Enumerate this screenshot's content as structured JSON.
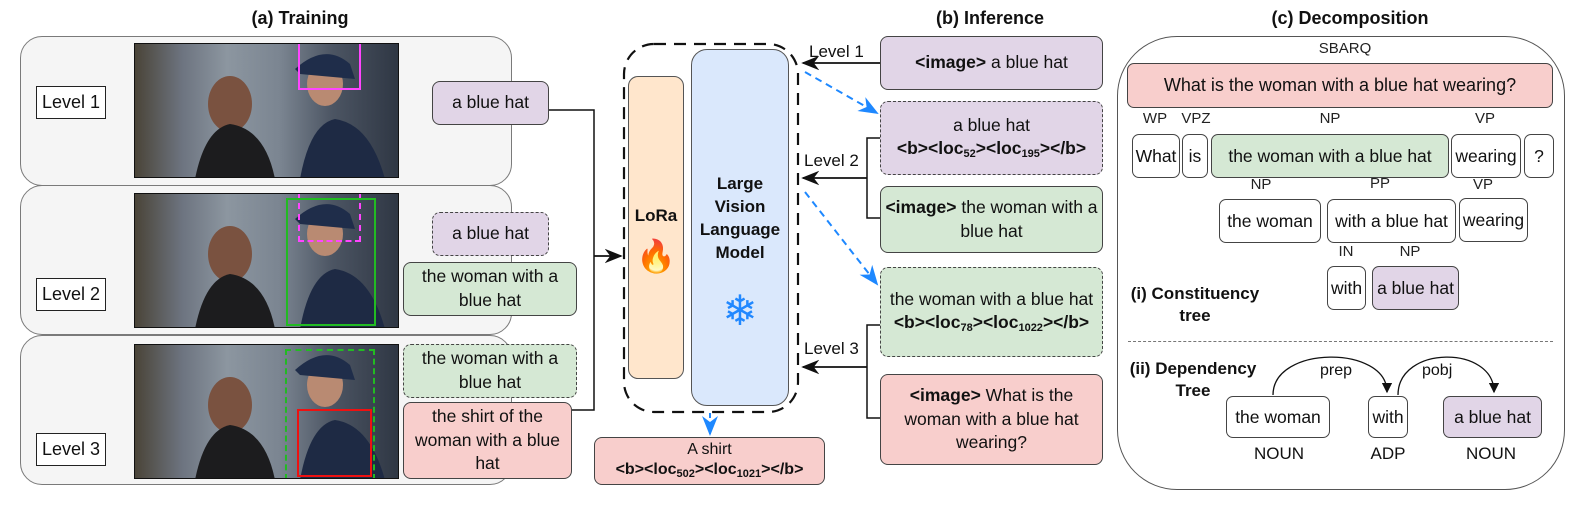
{
  "titles": {
    "training": "(a) Training",
    "inference": "(b) Inference",
    "decomposition": "(c) Decomposition"
  },
  "training": {
    "levels": [
      {
        "label": "Level 1",
        "image_boxes": [
          {
            "color": "#ff44ff",
            "style": "solid",
            "target": "hat"
          }
        ],
        "texts": [
          {
            "text": "a blue hat",
            "color": "#e1d5e7",
            "style": "solid"
          }
        ]
      },
      {
        "label": "Level 2",
        "image_boxes": [
          {
            "color": "#ff44ff",
            "style": "dashed",
            "target": "hat"
          },
          {
            "color": "#22bb22",
            "style": "solid",
            "target": "woman"
          }
        ],
        "texts": [
          {
            "text": "a blue hat",
            "color": "#e1d5e7",
            "style": "dashed"
          },
          {
            "text": "the woman with a blue hat",
            "color": "#d5e8d4",
            "style": "solid"
          }
        ]
      },
      {
        "label": "Level 3",
        "image_boxes": [
          {
            "color": "#22bb22",
            "style": "dashed",
            "target": "woman"
          },
          {
            "color": "#ee1111",
            "style": "solid",
            "target": "shirt"
          }
        ],
        "texts": [
          {
            "text": "the woman with a blue hat",
            "color": "#d5e8d4",
            "style": "dashed"
          },
          {
            "text": "the shirt of the woman with a blue hat",
            "color": "#f8cecc",
            "style": "solid"
          }
        ]
      }
    ]
  },
  "model": {
    "lora_label": "LoRa",
    "lora_icon": "fire-icon",
    "lora_glyph": "🔥",
    "lvlm_label": "Large Vision Language Model",
    "lvlm_icon": "snowflake-icon",
    "lvlm_glyph": "❄",
    "output": {
      "line1": "A shirt",
      "open": "<b><loc",
      "loc1": "502",
      "mid": "><loc",
      "loc2": "1021",
      "close": "></b>"
    }
  },
  "inference": {
    "arrow_labels": [
      "Level 1",
      "Level 2",
      "Level 3"
    ],
    "boxes": [
      {
        "bold": "<image>",
        "text": " a blue hat",
        "color": "#e1d5e7",
        "style": "solid"
      },
      {
        "text": "a blue hat",
        "tag_open": "<b><loc",
        "loc1": "52",
        "tag_mid": "><loc",
        "loc2": "195",
        "tag_close": "></b>",
        "color": "#e1d5e7",
        "style": "dashed"
      },
      {
        "bold": "<image>",
        "text": " the woman with a blue hat",
        "color": "#d5e8d4",
        "style": "solid"
      },
      {
        "text": "the woman with a blue hat ",
        "tag_open": "<b><loc",
        "loc1": "78",
        "tag_mid": "><loc",
        "loc2": "1022",
        "tag_close": "></b>",
        "color": "#d5e8d4",
        "style": "dashed"
      },
      {
        "bold": "<image>",
        "text": " What is the woman with a blue hat wearing?",
        "color": "#f8cecc",
        "style": "solid"
      }
    ]
  },
  "decomposition": {
    "root_tag": "SBARQ",
    "question": "What is the woman with a blue hat wearing?",
    "row1": {
      "tags": [
        "WP",
        "VPZ",
        "NP",
        "VP"
      ],
      "words": [
        "What",
        "is",
        "the woman with a blue hat",
        "wearing",
        "?"
      ]
    },
    "row2": {
      "tags": [
        "NP",
        "PP",
        "VP"
      ],
      "words": [
        "the woman",
        "with a blue hat",
        "wearing"
      ]
    },
    "row3": {
      "tags": [
        "IN",
        "NP"
      ],
      "words": [
        "with",
        "a blue hat"
      ]
    },
    "constituency_label": "(i) Constituency tree",
    "dependency_label": "(ii) Dependency Tree",
    "dependency": {
      "words": [
        "the woman",
        "with",
        "a blue hat"
      ],
      "pos": [
        "NOUN",
        "ADP",
        "NOUN"
      ],
      "arcs": [
        {
          "label": "prep",
          "from": "the woman",
          "to": "with"
        },
        {
          "label": "pobj",
          "from": "with",
          "to": "a blue hat"
        }
      ]
    }
  }
}
